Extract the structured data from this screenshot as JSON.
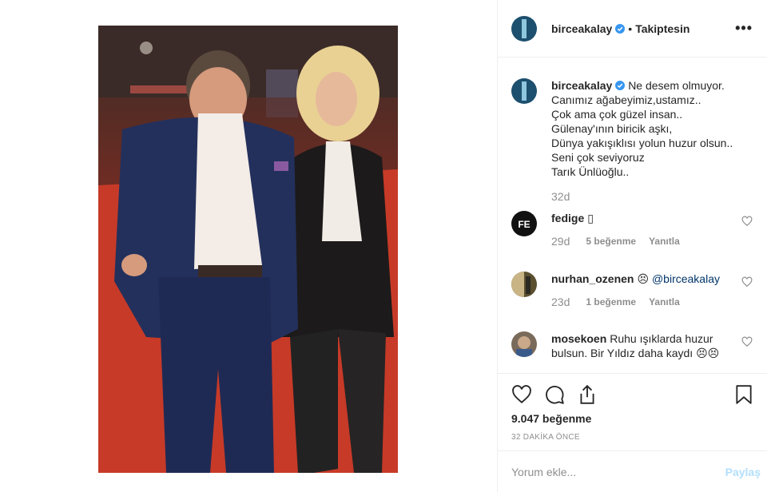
{
  "post": {
    "author": "birceakalay",
    "follow_status": "Takiptesin",
    "separator": "•",
    "more": "•••"
  },
  "caption": {
    "username": "birceakalay",
    "lines": [
      "Ne desem olmuyor.",
      "Canımız ağabeyimiz,ustamız..",
      "Çok ama çok güzel insan..",
      "Gülenay'ının biricik aşkı,",
      "Dünya yakışıklısı yolun huzur olsun..",
      "Seni çok seviyoruz",
      "Tarık Ünlüoğlu.."
    ],
    "time": "32d"
  },
  "comments": [
    {
      "username": "fedige",
      "text": "▯",
      "time": "29d",
      "likes": "5 beğenme",
      "reply": "Yanıtla"
    },
    {
      "username": "nurhan_ozenen",
      "text": "😣",
      "mention": "@birceakalay",
      "time": "23d",
      "likes": "1 beğenme",
      "reply": "Yanıtla"
    },
    {
      "username": "mosekoen",
      "text": "Ruhu ışıklarda huzur",
      "text2": "bulsun. Bir Yıldız daha kaydı 😣😣"
    }
  ],
  "likes_count": "9.047 beğenme",
  "posted_time": "32 DAKİKA ÖNCE",
  "comment_box": {
    "placeholder": "Yorum ekle...",
    "submit_label": "Paylaş"
  },
  "colors": {
    "verified": "#3897f0",
    "link": "#003569",
    "muted": "#8e8e8e",
    "submit_disabled": "#b2dffc"
  },
  "icons": [
    "verified-badge-icon",
    "more-options-icon",
    "heart-icon",
    "comment-icon",
    "share-icon",
    "bookmark-icon"
  ]
}
